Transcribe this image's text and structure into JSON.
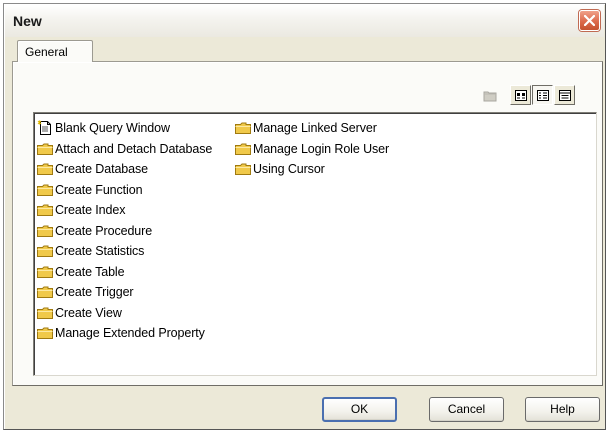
{
  "dialog": {
    "title": "New",
    "close_label": "Close"
  },
  "tabs": [
    {
      "label": "General",
      "selected": true
    }
  ],
  "toolbar": {
    "buttons": [
      {
        "name": "up-folder-icon",
        "state": "disabled"
      },
      {
        "name": "large-icons-view-icon",
        "state": "normal"
      },
      {
        "name": "list-view-icon",
        "state": "pressed"
      },
      {
        "name": "details-view-icon",
        "state": "normal"
      }
    ]
  },
  "list": {
    "items": [
      {
        "label": "Blank Query Window",
        "icon": "new-document-icon"
      },
      {
        "label": "Attach and Detach Database",
        "icon": "folder-icon"
      },
      {
        "label": "Create Database",
        "icon": "folder-icon"
      },
      {
        "label": "Create Function",
        "icon": "folder-icon"
      },
      {
        "label": "Create Index",
        "icon": "folder-icon"
      },
      {
        "label": "Create Procedure",
        "icon": "folder-icon"
      },
      {
        "label": "Create Statistics",
        "icon": "folder-icon"
      },
      {
        "label": "Create Table",
        "icon": "folder-icon"
      },
      {
        "label": "Create Trigger",
        "icon": "folder-icon"
      },
      {
        "label": "Create View",
        "icon": "folder-icon"
      },
      {
        "label": "Manage Extended Property",
        "icon": "folder-icon"
      },
      {
        "label": "Manage Linked Server",
        "icon": "folder-icon"
      },
      {
        "label": "Manage Login Role User",
        "icon": "folder-icon"
      },
      {
        "label": "Using Cursor",
        "icon": "folder-icon"
      }
    ]
  },
  "buttons": {
    "ok": "OK",
    "cancel": "Cancel",
    "help": "Help"
  },
  "colors": {
    "dialog_bg": "#ece9d8",
    "panel_bg": "#fbfbf8",
    "folder_fill": "#f0c94a",
    "close_red": "#dc6a4c",
    "default_button_border": "#4a6fb0"
  }
}
